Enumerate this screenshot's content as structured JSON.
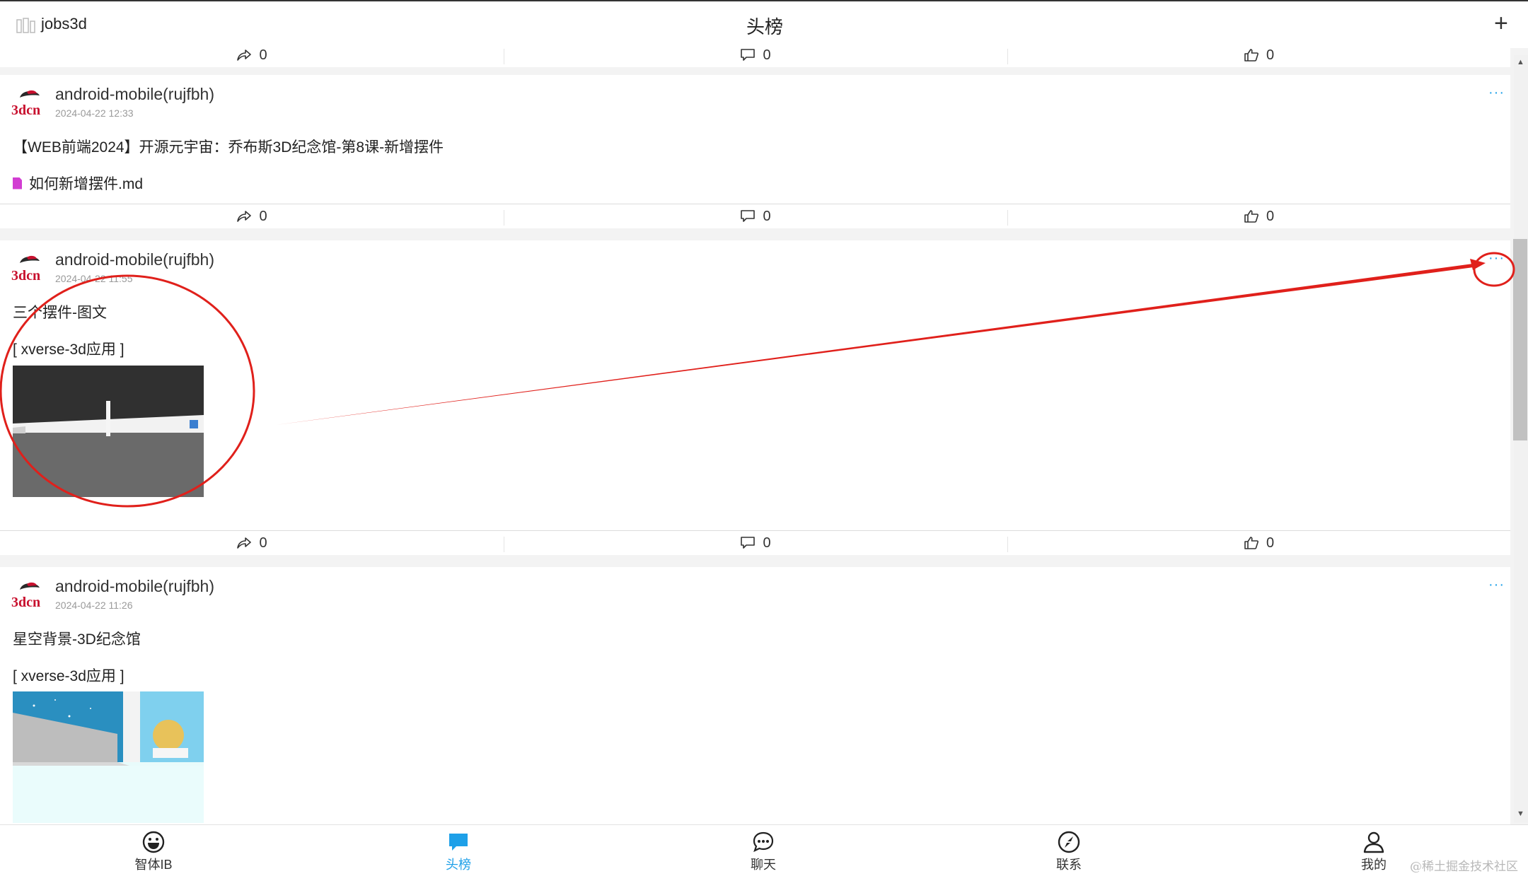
{
  "header": {
    "app_name": "jobs3d",
    "title": "头榜",
    "plus": "+"
  },
  "avatar_text": "3dcn",
  "actions": [
    {
      "share": "0",
      "comment": "0",
      "like": "0"
    },
    {
      "share": "0",
      "comment": "0",
      "like": "0"
    },
    {
      "share": "0",
      "comment": "0",
      "like": "0"
    }
  ],
  "posts": [
    {
      "author": "android-mobile(rujfbh)",
      "date": "2024-04-22 12:33",
      "text": "【WEB前端2024】开源元宇宙：乔布斯3D纪念馆-第8课-新增摆件",
      "file": "如何新增摆件.md",
      "more": "···"
    },
    {
      "author": "android-mobile(rujfbh)",
      "date": "2024-04-22 11:55",
      "text": "三个摆件-图文",
      "app_tag": "[ xverse-3d应用 ]",
      "more": "···"
    },
    {
      "author": "android-mobile(rujfbh)",
      "date": "2024-04-22 11:26",
      "text": "星空背景-3D纪念馆",
      "app_tag": "[ xverse-3d应用 ]",
      "more": "···"
    }
  ],
  "nav": [
    {
      "label": "智体IB",
      "icon": "smiley-icon"
    },
    {
      "label": "头榜",
      "icon": "chat-bubble-icon",
      "active": true
    },
    {
      "label": "聊天",
      "icon": "message-dots-icon"
    },
    {
      "label": "联系",
      "icon": "compass-icon"
    },
    {
      "label": "我的",
      "icon": "user-icon"
    }
  ],
  "watermark": "@稀土掘金技术社区",
  "colors": {
    "accent": "#1ea0e8",
    "annotation": "#e0201b",
    "avatar_red": "#c8102e"
  }
}
